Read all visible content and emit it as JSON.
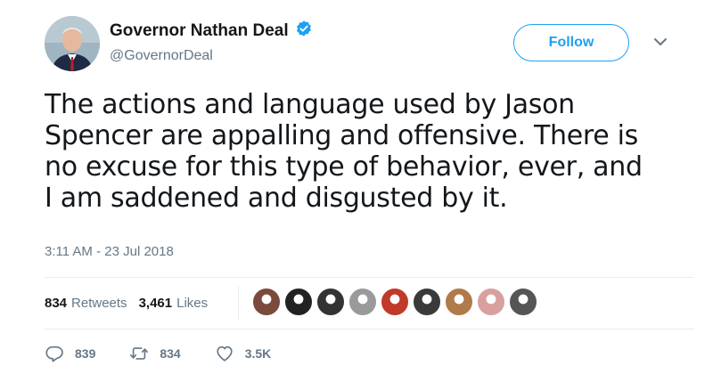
{
  "author": {
    "display_name": "Governor Nathan Deal",
    "handle": "@GovernorDeal",
    "verified": true
  },
  "follow_button": {
    "label": "Follow"
  },
  "tweet": {
    "lines": [
      "The actions and language used by Jason",
      "Spencer are appalling and offensive. There is",
      "no excuse for this type of behavior, ever, and",
      "I am saddened and disgusted by it."
    ],
    "timestamp": "3:11 AM - 23 Jul 2018"
  },
  "stats": {
    "retweets_count": "834",
    "retweets_label": "Retweets",
    "likes_count": "3,461",
    "likes_label": "Likes"
  },
  "liker_avatars": [
    {
      "name": "liker-avatar-1",
      "color": "#7a4a3a"
    },
    {
      "name": "liker-avatar-2",
      "color": "#222222"
    },
    {
      "name": "liker-avatar-3",
      "color": "#333333"
    },
    {
      "name": "liker-avatar-4",
      "color": "#9a9a9a"
    },
    {
      "name": "liker-avatar-5",
      "color": "#c0392b"
    },
    {
      "name": "liker-avatar-6",
      "color": "#3a3a3a"
    },
    {
      "name": "liker-avatar-7",
      "color": "#b07a4a"
    },
    {
      "name": "liker-avatar-8",
      "color": "#d9a0a0"
    },
    {
      "name": "liker-avatar-9",
      "color": "#555555"
    }
  ],
  "actions": {
    "reply_count": "839",
    "retweet_count": "834",
    "like_count": "3.5K"
  },
  "colors": {
    "accent": "#1da1f2",
    "text": "#14171a",
    "secondary": "#657786",
    "divider": "#e6ecf0"
  }
}
